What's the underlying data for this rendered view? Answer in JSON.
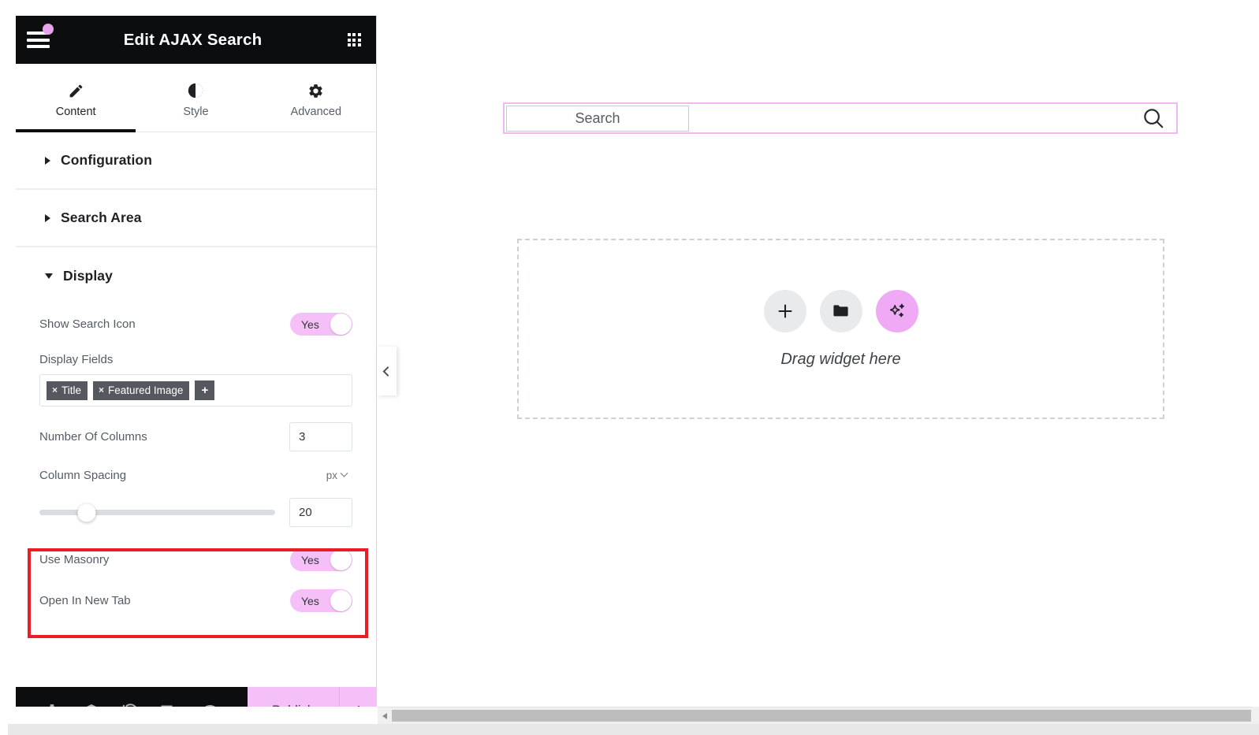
{
  "panel": {
    "title": "Edit AJAX Search",
    "menu_icon": "hamburger-icon",
    "apps_icon": "apps-grid-icon",
    "tabs": [
      {
        "label": "Content",
        "icon": "pencil-icon",
        "active": true
      },
      {
        "label": "Style",
        "icon": "contrast-icon",
        "active": false
      },
      {
        "label": "Advanced",
        "icon": "gear-icon",
        "active": false
      }
    ],
    "sections": [
      {
        "title": "Configuration",
        "open": false
      },
      {
        "title": "Search Area",
        "open": false
      },
      {
        "title": "Display",
        "open": true
      }
    ],
    "display": {
      "show_search_icon": {
        "label": "Show Search Icon",
        "value": "Yes"
      },
      "display_fields": {
        "label": "Display Fields",
        "tags": [
          {
            "remove": "×",
            "label": "Title"
          },
          {
            "remove": "×",
            "label": "Featured Image"
          }
        ],
        "add_label": "+"
      },
      "number_of_columns": {
        "label": "Number Of Columns",
        "value": "3"
      },
      "column_spacing": {
        "label": "Column Spacing",
        "unit": "px",
        "value": "20",
        "slider_percent": 20
      },
      "use_masonry": {
        "label": "Use Masonry",
        "value": "Yes"
      },
      "open_in_new_tab": {
        "label": "Open In New Tab",
        "value": "Yes"
      }
    },
    "footer": {
      "icons": [
        "gear-icon",
        "layers-icon",
        "history-icon",
        "responsive-icon",
        "preview-eye-icon"
      ],
      "publish_label": "Publish",
      "publish_caret_icon": "chevron-up-icon"
    },
    "collapse_handle_icon": "chevron-left-icon"
  },
  "canvas": {
    "search_widget": {
      "placeholder": "Search",
      "search_icon": "magnifier-icon"
    },
    "dropzone": {
      "text": "Drag widget here",
      "buttons": [
        {
          "icon": "plus-icon",
          "name": "add-element-button"
        },
        {
          "icon": "folder-icon",
          "name": "add-template-button"
        },
        {
          "icon": "ai-sparkle-icon",
          "name": "ai-builder-button"
        }
      ]
    }
  },
  "colors": {
    "accent_pink": "#f4c0f7",
    "widget_outline_pink": "#efb9f3",
    "highlight_red": "#ed1c24",
    "header_black": "#0c0d0e"
  }
}
